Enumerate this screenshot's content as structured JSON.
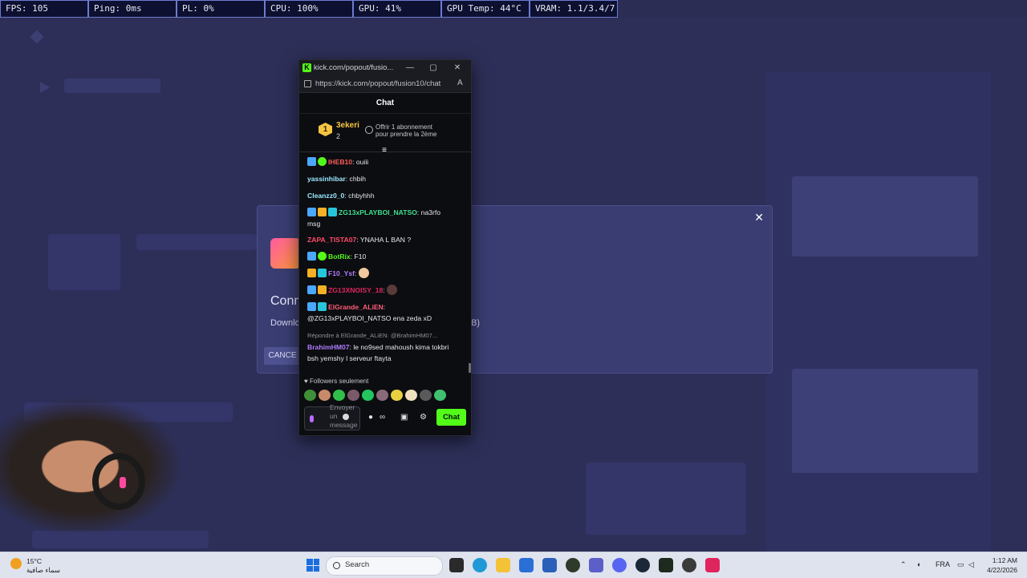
{
  "perf": [
    "FPS: 105",
    "Ping: 0ms",
    "PL: 0%",
    "CPU: 100%",
    "GPU: 41%",
    "GPU Temp: 44°C",
    "VRAM: 1.1/3.4/7.7 GB"
  ],
  "modal": {
    "title": "Conn",
    "desc": "Downlo",
    "size": "B)",
    "cancel": "CANCE"
  },
  "chat_window": {
    "title": "kick.com/popout/fusio...",
    "url": "https://kick.com/popout/fusion10/chat",
    "header": "Chat",
    "pinned": {
      "rank": "1",
      "name": "3ekeri",
      "count": "2",
      "gift_line1": "Offrir 1 abonnement",
      "gift_line2": "pour prendre la 2ème"
    },
    "messages": [
      {
        "user": "IHEB10",
        "text": ": ouiii"
      },
      {
        "user": "yassinhibar",
        "text": ": chbih"
      },
      {
        "user": "Cleanzz0_0",
        "text": ": chbyhhh"
      },
      {
        "user": "ZG13xPLAYBOI_NATSO",
        "text": ": na3rfo",
        "text2": "msg"
      },
      {
        "user": "ZAPA_TISTA07",
        "text": ": YNAHA L BAN ?"
      },
      {
        "user": "BotRix",
        "text": ": F10"
      },
      {
        "user": "F10_Ysf",
        "text": ":"
      },
      {
        "user": "ZG13XNOISY_18",
        "text": ":"
      },
      {
        "user": "ElGrande_ALiEN",
        "text": ":",
        "text2": "@ZG13xPLAYBOI_NATSO ena zeda xD"
      },
      {
        "reply": "Répondre à ElGrande_ALiEN: @BrahimHM07...",
        "user": "BrahimHM07",
        "text": ": le no9sed mahoush kima tokbri",
        "text2": "bsh yemshy l serveur ftayta"
      }
    ],
    "followers_only": "Followers seulement",
    "input_placeholder": "Envoyer un message",
    "send": "Chat"
  },
  "taskbar": {
    "temp": "15°C",
    "weather": "سماء صافية",
    "search": "Search",
    "lang": "FRA",
    "time": "1:12 AM",
    "date": "4/22/2026"
  },
  "colors": {
    "kick_green": "#53fc18",
    "gold": "#f5c542",
    "background": "#2d2f58"
  }
}
